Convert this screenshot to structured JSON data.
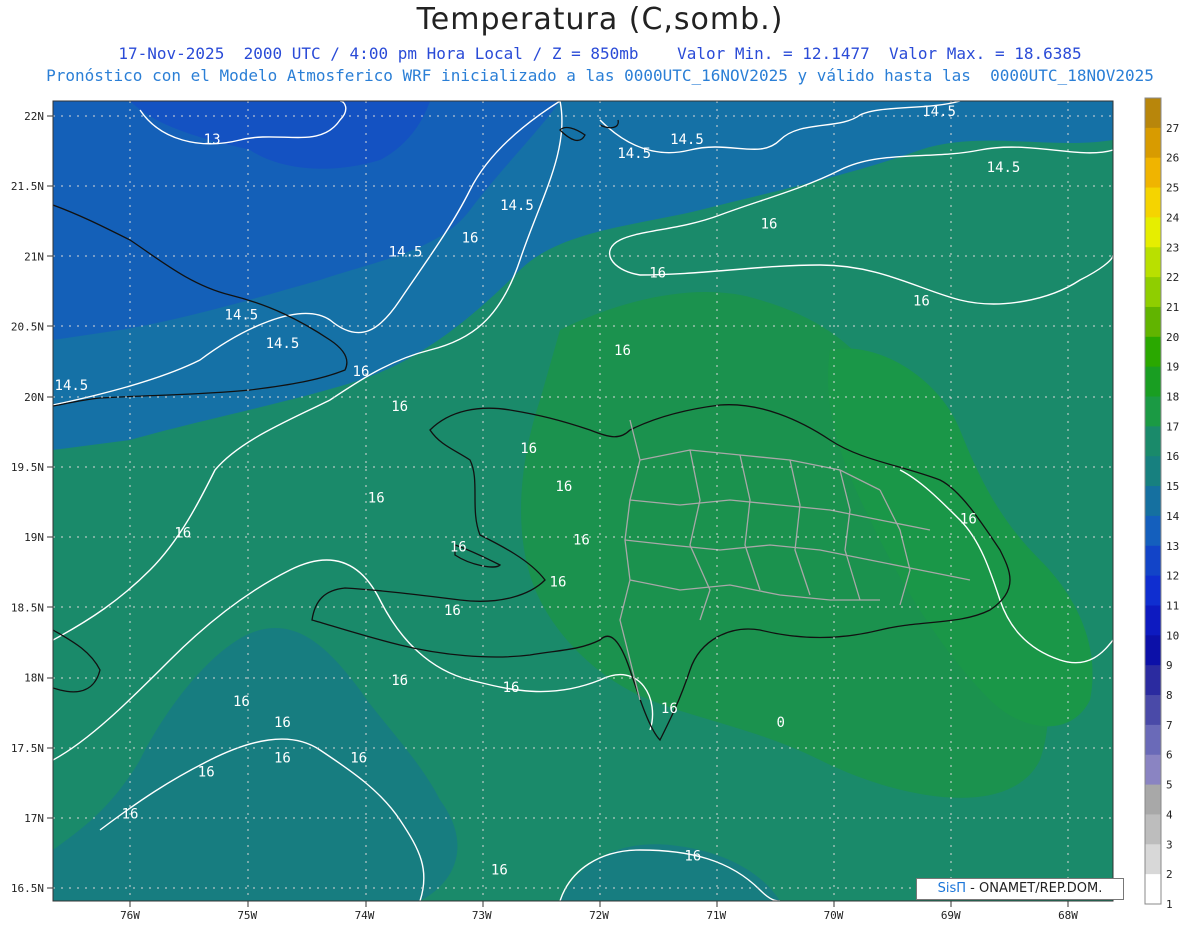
{
  "title": "Temperatura (C,somb.)",
  "subtitle_line1": "17-Nov-2025  2000 UTC / 4:00 pm Hora Local / Z = 850mb    Valor Min. = 12.1477  Valor Max. = 18.6385",
  "subtitle_line2": "Pronóstico con el Modelo Atmosferico WRF inicializado a las 0000UTC_16NOV2025 y válido hasta las  0000UTC_18NOV2025",
  "credit": {
    "sis": "SisΠ",
    "rest": " - ONAMET/REP.DOM."
  },
  "lat_labels": [
    "22N",
    "21.5N",
    "21N",
    "20.5N",
    "20N",
    "19.5N",
    "19N",
    "18.5N",
    "18N",
    "17.5N",
    "17N",
    "16.5N"
  ],
  "lon_labels": [
    "76W",
    "75W",
    "74W",
    "73W",
    "72W",
    "71W",
    "70W",
    "69W",
    "68W"
  ],
  "colorbar": {
    "labels": [
      "27",
      "26",
      "25",
      "24",
      "23",
      "22",
      "21",
      "20",
      "19",
      "18",
      "17",
      "16",
      "15",
      "14",
      "13",
      "12",
      "11",
      "10",
      "9",
      "8",
      "7",
      "6",
      "5",
      "4",
      "3",
      "2",
      "1"
    ],
    "colors": [
      "#b8860b",
      "#d89b00",
      "#f0b400",
      "#f5d400",
      "#e6ee00",
      "#b9e000",
      "#8fce00",
      "#61b400",
      "#2aa800",
      "#199e22",
      "#1b9a44",
      "#1a8a6a",
      "#17807f",
      "#1570a0",
      "#145fbd",
      "#1244c8",
      "#0f2ed0",
      "#0d1ac0",
      "#0c10a8",
      "#2b2ba0",
      "#4a4aa8",
      "#6a6ab8",
      "#8a84c2",
      "#a8a8a8",
      "#bdbdbd",
      "#d8d8d8",
      "#ffffff"
    ]
  },
  "contour_labels": [
    {
      "t": "13",
      "lat": 21.8,
      "lon": -75.3
    },
    {
      "t": "14.5",
      "lat": 21.0,
      "lon": -73.65
    },
    {
      "t": "14.5",
      "lat": 21.33,
      "lon": -72.7
    },
    {
      "t": "14.5",
      "lat": 21.7,
      "lon": -71.7
    },
    {
      "t": "14.5",
      "lat": 21.8,
      "lon": -71.25
    },
    {
      "t": "14.5",
      "lat": 22.0,
      "lon": -69.1
    },
    {
      "t": "14.5",
      "lat": 21.6,
      "lon": -68.55
    },
    {
      "t": "14.5",
      "lat": 20.55,
      "lon": -75.05
    },
    {
      "t": "14.5",
      "lat": 20.35,
      "lon": -74.7
    },
    {
      "t": "14.5",
      "lat": 20.05,
      "lon": -76.5
    },
    {
      "t": "16",
      "lat": 21.1,
      "lon": -73.1
    },
    {
      "t": "16",
      "lat": 20.85,
      "lon": -71.5
    },
    {
      "t": "16",
      "lat": 21.2,
      "lon": -70.55
    },
    {
      "t": "16",
      "lat": 20.65,
      "lon": -69.25
    },
    {
      "t": "16",
      "lat": 20.3,
      "lon": -71.8
    },
    {
      "t": "16",
      "lat": 20.15,
      "lon": -74.03
    },
    {
      "t": "16",
      "lat": 19.9,
      "lon": -73.7
    },
    {
      "t": "16",
      "lat": 19.6,
      "lon": -72.6
    },
    {
      "t": "16",
      "lat": 19.33,
      "lon": -72.3
    },
    {
      "t": "16",
      "lat": 19.25,
      "lon": -73.9
    },
    {
      "t": "16",
      "lat": 19.0,
      "lon": -75.55
    },
    {
      "t": "16",
      "lat": 18.95,
      "lon": -72.15
    },
    {
      "t": "16",
      "lat": 18.9,
      "lon": -73.2
    },
    {
      "t": "16",
      "lat": 18.65,
      "lon": -72.35
    },
    {
      "t": "16",
      "lat": 18.45,
      "lon": -73.25
    },
    {
      "t": "16",
      "lat": 17.95,
      "lon": -73.7
    },
    {
      "t": "16",
      "lat": 17.9,
      "lon": -72.75
    },
    {
      "t": "16",
      "lat": 17.8,
      "lon": -75.05
    },
    {
      "t": "16",
      "lat": 17.75,
      "lon": -71.4
    },
    {
      "t": "16",
      "lat": 17.65,
      "lon": -74.7
    },
    {
      "t": "16",
      "lat": 17.4,
      "lon": -74.7
    },
    {
      "t": "16",
      "lat": 17.4,
      "lon": -74.05
    },
    {
      "t": "16",
      "lat": 17.3,
      "lon": -75.35
    },
    {
      "t": "16",
      "lat": 17.0,
      "lon": -76.0
    },
    {
      "t": "16",
      "lat": 16.6,
      "lon": -72.85
    },
    {
      "t": "16",
      "lat": 16.7,
      "lon": -71.2
    },
    {
      "t": "16",
      "lat": 19.1,
      "lon": -68.85
    },
    {
      "t": "0",
      "lat": 17.65,
      "lon": -70.45
    }
  ]
}
